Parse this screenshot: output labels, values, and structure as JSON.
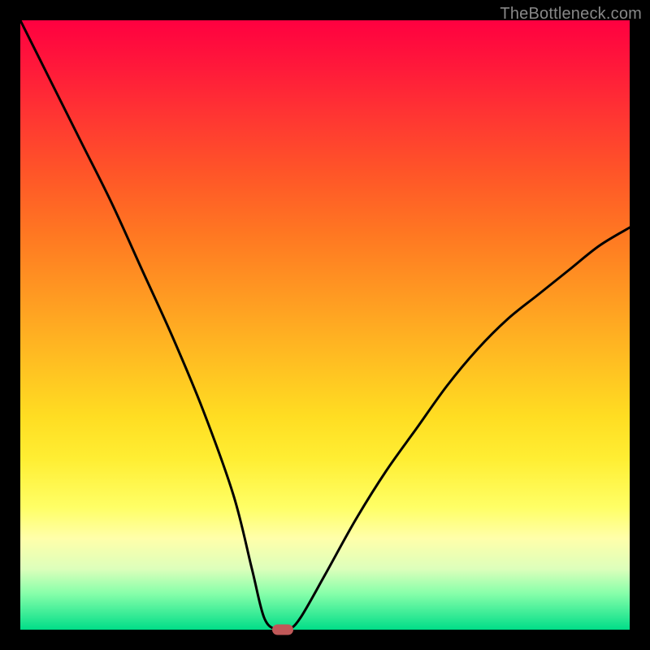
{
  "watermark": "TheBottleneck.com",
  "colors": {
    "frame": "#000000",
    "curve": "#000000",
    "marker": "#c05858",
    "watermark": "#888888"
  },
  "chart_data": {
    "type": "line",
    "title": "",
    "xlabel": "",
    "ylabel": "",
    "x": [
      0,
      5,
      10,
      15,
      20,
      25,
      30,
      35,
      38,
      40,
      42,
      44,
      46,
      50,
      55,
      60,
      65,
      70,
      75,
      80,
      85,
      90,
      95,
      100
    ],
    "values": [
      100,
      90,
      80,
      70,
      59,
      48,
      36,
      22,
      10,
      2,
      0,
      0,
      2,
      9,
      18,
      26,
      33,
      40,
      46,
      51,
      55,
      59,
      63,
      66
    ],
    "xlim": [
      0,
      100
    ],
    "ylim": [
      0,
      100
    ],
    "marker_points": [
      {
        "x": 43,
        "y": 0
      }
    ],
    "gradient_stops_y_to_color": [
      {
        "y": 100,
        "color": "#ff0040"
      },
      {
        "y": 75,
        "color": "#ff5528"
      },
      {
        "y": 50,
        "color": "#ffbb22"
      },
      {
        "y": 25,
        "color": "#ffee33"
      },
      {
        "y": 10,
        "color": "#ffffaa"
      },
      {
        "y": 3,
        "color": "#44ee99"
      },
      {
        "y": 0,
        "color": "#00dd88"
      }
    ]
  }
}
